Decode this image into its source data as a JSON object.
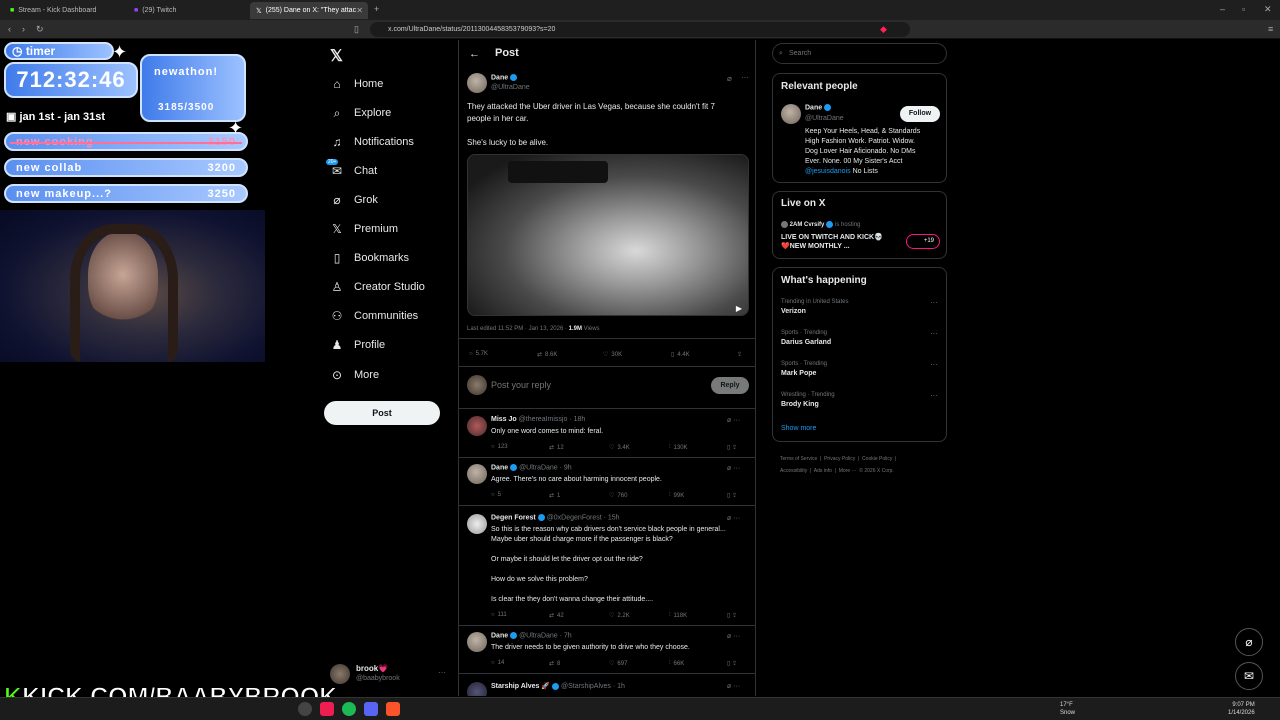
{
  "browser": {
    "tabs": [
      {
        "label": "Stream - Kick Dashboard"
      },
      {
        "label": "(29) Twitch"
      },
      {
        "label": "(255) Dane on X: \"They attac"
      }
    ],
    "url": "x.com/UltraDane/status/2011300445835379093?s=20"
  },
  "overlay": {
    "timer_label": "timer",
    "timer_value": "712:32:46",
    "date_range": "jan 1st - jan 31st",
    "goal_title": "newathon!",
    "goal_count": "3185/3500",
    "goals": [
      {
        "label": "new cooking",
        "value": "3150"
      },
      {
        "label": "new collab",
        "value": "3200"
      },
      {
        "label": "new makeup...?",
        "value": "3250"
      }
    ],
    "kick_url": "KICK.COM/BAABYBROOK"
  },
  "nav": {
    "items": [
      {
        "label": "Home",
        "icon": "home-icon"
      },
      {
        "label": "Explore",
        "icon": "search-icon"
      },
      {
        "label": "Notifications",
        "icon": "bell-icon"
      },
      {
        "label": "Chat",
        "icon": "chat-icon",
        "badge": "20+"
      },
      {
        "label": "Grok",
        "icon": "grok-icon"
      },
      {
        "label": "Premium",
        "icon": "x-icon"
      },
      {
        "label": "Bookmarks",
        "icon": "bookmark-icon"
      },
      {
        "label": "Creator Studio",
        "icon": "creator-icon"
      },
      {
        "label": "Communities",
        "icon": "communities-icon"
      },
      {
        "label": "Profile",
        "icon": "profile-icon"
      },
      {
        "label": "More",
        "icon": "more-icon"
      }
    ],
    "post_button": "Post",
    "account": {
      "name": "brook💗",
      "handle": "@baabybrook"
    }
  },
  "post": {
    "header": "Post",
    "author": "Dane",
    "handle": "@UltraDane",
    "text1": "They attacked the Uber driver in Las Vegas, because she couldn't fit 7",
    "text2": "people in her car.",
    "text3": "She's lucky to be alive.",
    "meta_edited": "Last edited 11:52 PM · Jan 13, 2026 ·",
    "views": "1.9M",
    "views_label": "Views",
    "stats": {
      "replies": "5.7K",
      "reposts": "8.6K",
      "likes": "30K",
      "bookmarks": "4.4K"
    },
    "reply_placeholder": "Post your reply",
    "reply_button": "Reply"
  },
  "replies": [
    {
      "name": "Miss Jo",
      "handle": "@thereaImissjo · 18h",
      "lines": [
        "Only one word comes to mind: feral."
      ],
      "stats": [
        "123",
        "12",
        "3.4K",
        "130K"
      ]
    },
    {
      "name": "Dane",
      "handle": "@UltraDane · 9h",
      "lines": [
        "Agree. There's no care about harming innocent people."
      ],
      "stats": [
        "5",
        "1",
        "760",
        "99K"
      ]
    },
    {
      "name": "Degen Forest",
      "handle": "@0xDegenForest · 15h",
      "lines": [
        "So this is the reason why cab drivers don't service black people in general...",
        "Maybe uber should charge more if the passenger is black?",
        "",
        "Or maybe it should let the driver opt out the ride?",
        "",
        "How do we solve this problem?",
        "",
        "Is clear the they don't wanna change their attitude...."
      ],
      "stats": [
        "111",
        "42",
        "2.2K",
        "118K"
      ]
    },
    {
      "name": "Dane",
      "handle": "@UltraDane · 7h",
      "lines": [
        "The driver needs to be given authority to drive who they choose."
      ],
      "stats": [
        "14",
        "8",
        "697",
        "66K"
      ]
    },
    {
      "name": "Starship Alves 🚀",
      "handle": "@StarshipAlves · 1h",
      "lines": [
        ""
      ],
      "stats": [
        "",
        "",
        "",
        ""
      ]
    }
  ],
  "right": {
    "search_placeholder": "Search",
    "relevant_title": "Relevant people",
    "person": {
      "name": "Dane",
      "handle": "@UltraDane",
      "follow": "Follow",
      "bio1": "Keep Your Heels, Head, & Standards",
      "bio2": "High Fashion Work. Patriot. Widow.",
      "bio3": "Dog Lover Hair Aficionado. No DMs",
      "bio4": "Ever. None. 00 My Sister's Acct",
      "bio_link": "@jesuisdanois",
      "bio_tail": "No Lists"
    },
    "live_title": "Live on X",
    "live_host": "2AM Cvrsify",
    "live_hosting": "is hosting",
    "live_text1": "LIVE ON TWITCH AND KICK💀",
    "live_text2": "❤️NEW MONTHLY ...",
    "live_count": "+19",
    "happening_title": "What's happening",
    "trends": [
      {
        "context": "Trending in United States",
        "name": "Verizon"
      },
      {
        "context": "Sports · Trending",
        "name": "Darius Garland"
      },
      {
        "context": "Sports · Trending",
        "name": "Mark Pope"
      },
      {
        "context": "Wrestling · Trending",
        "name": "Brody King"
      }
    ],
    "show_more": "Show more",
    "footer1": "Terms of Service  |  Privacy Policy  |  Cookie Policy  |",
    "footer2": "Accessibility  |  Ads info  |  More ···  © 2026 X Corp."
  },
  "taskbar": {
    "weather_temp": "17°F",
    "weather_label": "Snow",
    "time": "9:07 PM",
    "date": "1/14/2026"
  },
  "colors": {
    "accent": "#1d9bf0",
    "background": "#000000",
    "border": "#2f3336",
    "muted": "#71767b"
  }
}
